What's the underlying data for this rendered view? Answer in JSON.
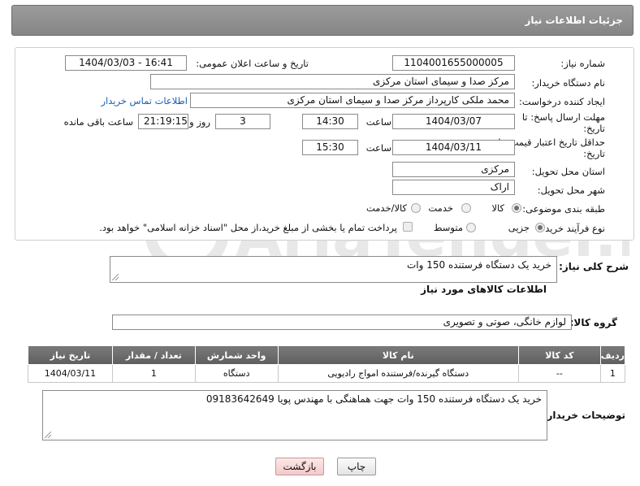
{
  "header": {
    "title": "جزئیات اطلاعات نیاز"
  },
  "fields": {
    "need_number_label": "شماره نیاز:",
    "need_number": "1104001655000005",
    "announce_label": "تاریخ و ساعت اعلان عمومی:",
    "announce_value": "1404/03/03 - 16:41",
    "buyer_org_label": "نام دستگاه خریدار:",
    "buyer_org": "مرکز صدا و سیمای استان مرکزی",
    "requester_label": "ایجاد کننده درخواست:",
    "requester": "محمد ملکی کارپرداز مرکز صدا و سیمای استان مرکزی",
    "contact_link": "اطلاعات تماس خریدار",
    "deadline_label": "مهلت ارسال پاسخ: تا تاریخ:",
    "deadline_date": "1404/03/07",
    "time_label": "ساعت",
    "deadline_time": "14:30",
    "days_value": "3",
    "days_label": "روز و",
    "remaining_time": "21:19:15",
    "remaining_label": "ساعت باقی مانده",
    "validity_label": "حداقل تاریخ اعتبار قیمت: تا تاریخ:",
    "validity_date": "1404/03/11",
    "validity_time": "15:30",
    "province_label": "استان محل تحویل:",
    "province": "مرکزی",
    "city_label": "شهر محل تحویل:",
    "city": "اراک",
    "category_label": "طبقه بندی موضوعی:",
    "category_options": [
      "کالا",
      "خدمت",
      "کالا/خدمت"
    ],
    "process_label": "نوع فرآیند خرید :",
    "process_options": [
      "جزیی",
      "متوسط"
    ],
    "payment_note": "پرداخت تمام یا بخشی از مبلغ خرید،از محل \"اسناد خزانه اسلامی\" خواهد بود."
  },
  "description": {
    "label": "شرح کلی نیاز:",
    "value": "خرید یک دستگاه فرستنده 150 وات"
  },
  "goods": {
    "section_title": "اطلاعات کالاهای مورد نیاز",
    "group_label": "گروه کالا:",
    "group_value": "لوازم خانگی، صوتی و تصویری",
    "columns": [
      "ردیف",
      "کد کالا",
      "نام کالا",
      "واحد شمارش",
      "تعداد / مقدار",
      "تاریخ نیاز"
    ],
    "rows": [
      [
        "1",
        "--",
        "دستگاه گیرنده/فرستنده امواج رادیویی",
        "دستگاه",
        "1",
        "1404/03/11"
      ]
    ]
  },
  "buyer_notes": {
    "label": "توضیحات خریدار:",
    "value": "خرید یک دستگاه فرستنده 150 وات جهت هماهنگی با مهندس پویا 09183642649"
  },
  "buttons": {
    "print": "چاپ",
    "back": "بازگشت"
  },
  "watermark": "AriaTender.neT"
}
